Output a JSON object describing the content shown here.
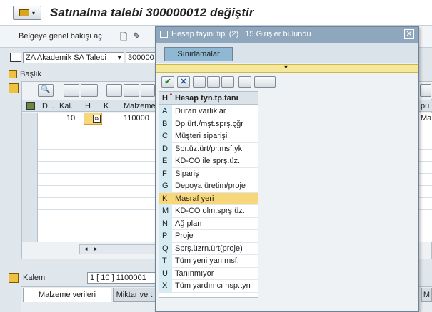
{
  "title": "Satınalma talebi 300000012 değiştir",
  "toolbar": {
    "overview_label": "Belgeye genel bakışı aç"
  },
  "doc_type": {
    "selected": "ZA Akademik SA Talebi",
    "number": "300000"
  },
  "header_section": "Başlık",
  "table": {
    "columns": [
      "D...",
      "Kal...",
      "H",
      "K",
      "Malzeme",
      "pu"
    ],
    "row1": {
      "kal": "10",
      "malzeme": "110000",
      "right": "Malz"
    }
  },
  "item_section": {
    "label": "Kalem",
    "value": "1 [ 10 ] 1100001"
  },
  "bottom_tabs": [
    "Malzeme verileri",
    "Miktar ve t",
    "M"
  ],
  "popup": {
    "title": "Hesap tayini tipi (2)   15 Girişler bulundu",
    "tab": "Sınırlamalar",
    "col_h": "H",
    "col_desc": "Hesap tyn.tp.tanı",
    "rows": [
      {
        "code": "A",
        "desc": "Duran varlıklar"
      },
      {
        "code": "B",
        "desc": "Dp.ürt./mşt.sprş.çğr"
      },
      {
        "code": "C",
        "desc": "Müşteri siparişi"
      },
      {
        "code": "D",
        "desc": "Spr.üz.ürt/pr.msf.yk"
      },
      {
        "code": "E",
        "desc": "KD-CO ile sprş.üz."
      },
      {
        "code": "F",
        "desc": "Sipariş"
      },
      {
        "code": "G",
        "desc": "Depoya üretim/proje"
      },
      {
        "code": "K",
        "desc": "Masraf yeri"
      },
      {
        "code": "M",
        "desc": "KD-CO olm.sprş.üz."
      },
      {
        "code": "N",
        "desc": "Ağ plan"
      },
      {
        "code": "P",
        "desc": "Proje"
      },
      {
        "code": "Q",
        "desc": "Sprş.üzrn.ürt(proje)"
      },
      {
        "code": "T",
        "desc": "Tüm yeni yan msf."
      },
      {
        "code": "U",
        "desc": "Tanınmıyor"
      },
      {
        "code": "X",
        "desc": "Tüm yardımcı hsp.tyn"
      }
    ],
    "selected_index": 7
  },
  "colors": {
    "title_bg": "#ffffff",
    "popup_title_bg": "#8fa7bd",
    "selected_row": "#f7d77a",
    "code_col": "#d5ecf5",
    "yellow_bar": "#f5e89a"
  }
}
